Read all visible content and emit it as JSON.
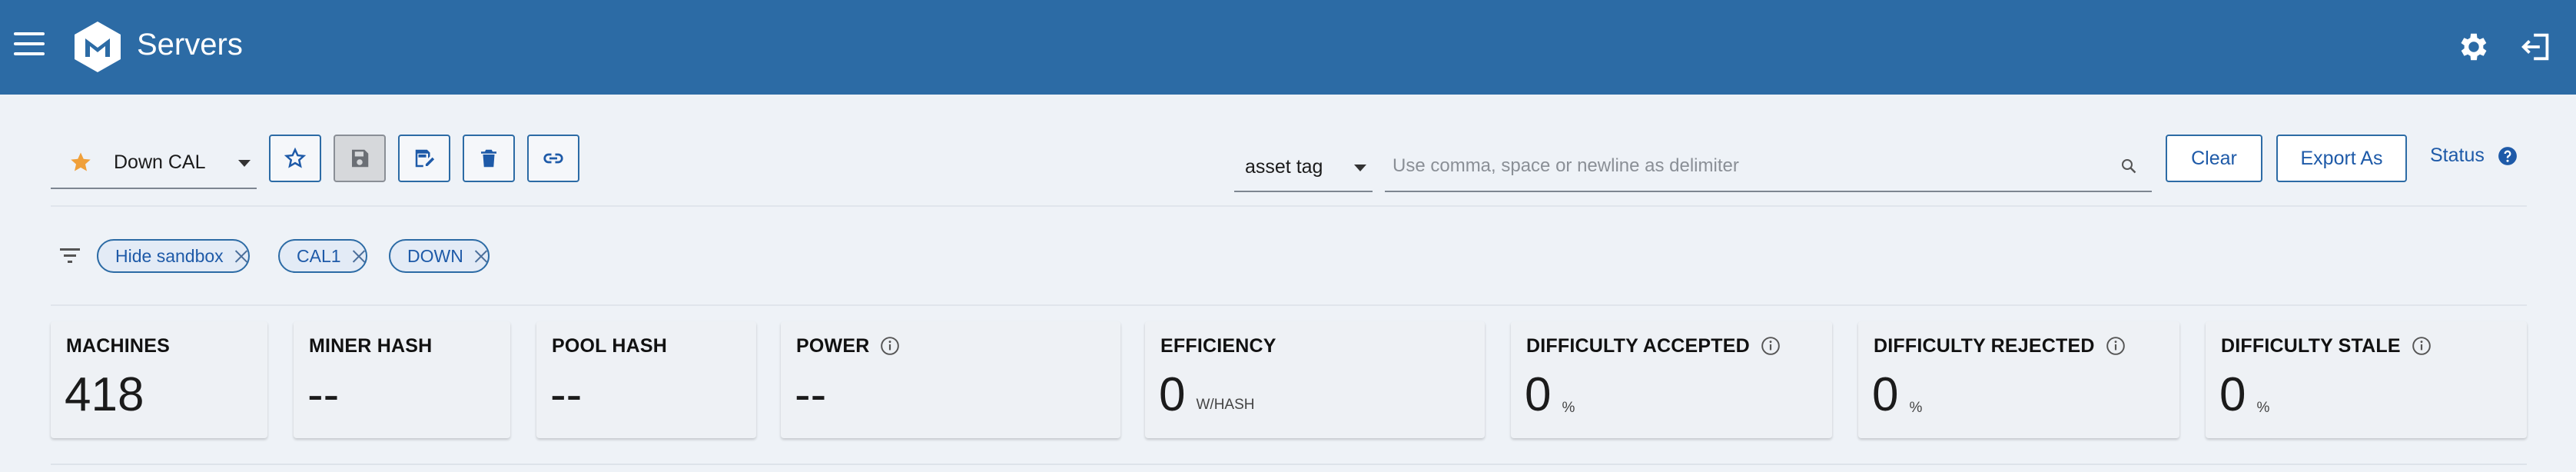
{
  "header": {
    "title": "Servers",
    "bg_color": "#2c6ba5"
  },
  "toolbar": {
    "view_name": "Down CAL",
    "field_selected": "asset tag",
    "search_placeholder": "Use comma, space or newline as delimiter",
    "search_value": "",
    "clear_label": "Clear",
    "export_label": "Export As",
    "status_label": "Status",
    "icon_buttons": [
      "star-outline-icon",
      "save-icon",
      "save-edit-icon",
      "trash-icon",
      "link-icon"
    ]
  },
  "filters": {
    "chips": [
      {
        "label": "Hide sandbox"
      },
      {
        "label": "CAL1"
      },
      {
        "label": "DOWN"
      }
    ]
  },
  "stats": [
    {
      "title": "MACHINES",
      "value": "418",
      "unit": "",
      "info": false
    },
    {
      "title": "MINER HASH",
      "value": "--",
      "unit": "",
      "info": false
    },
    {
      "title": "POOL HASH",
      "value": "--",
      "unit": "",
      "info": false
    },
    {
      "title": "POWER",
      "value": "--",
      "unit": "",
      "info": true
    },
    {
      "title": "EFFICIENCY",
      "value": "0",
      "unit": "W/HASH",
      "info": false
    },
    {
      "title": "DIFFICULTY ACCEPTED",
      "value": "0",
      "unit": "%",
      "info": true
    },
    {
      "title": "DIFFICULTY REJECTED",
      "value": "0",
      "unit": "%",
      "info": true
    },
    {
      "title": "DIFFICULTY STALE",
      "value": "0",
      "unit": "%",
      "info": true
    }
  ],
  "colors": {
    "accent": "#1e5aa8",
    "star": "#f0a03a"
  }
}
